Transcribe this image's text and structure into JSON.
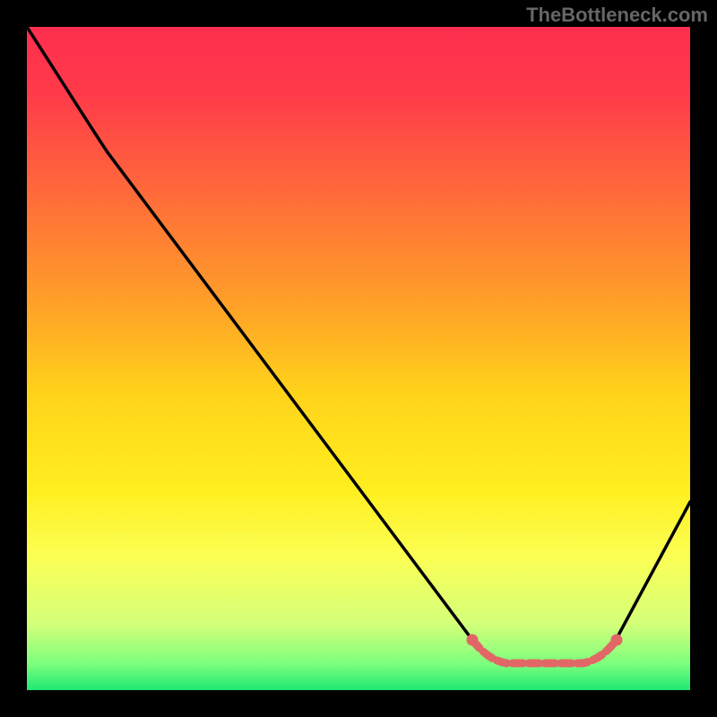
{
  "watermark": "TheBottleneck.com",
  "chart_data": {
    "type": "line",
    "title": "",
    "xlabel": "",
    "ylabel": "",
    "xlim": [
      0,
      100
    ],
    "ylim": [
      0,
      100
    ],
    "grid": false,
    "legend": false,
    "background_gradient": {
      "top": "#ff2e4f",
      "mid_top": "#ff9a2a",
      "mid": "#ffef20",
      "mid_bottom": "#d4ff7a",
      "bottom": "#1fe874"
    },
    "series": [
      {
        "name": "curve",
        "color": "#000000",
        "x": [
          0,
          5,
          10,
          15,
          20,
          25,
          30,
          35,
          40,
          45,
          50,
          55,
          60,
          63,
          66,
          70,
          75,
          80,
          83,
          86,
          90,
          95,
          100
        ],
        "y": [
          100,
          93,
          85,
          79,
          72,
          65,
          58,
          51,
          44,
          37,
          30,
          23,
          16,
          11,
          7,
          5,
          4,
          4,
          5,
          7,
          11,
          20,
          28
        ]
      },
      {
        "name": "optimal-range-highlight",
        "color": "#e16767",
        "style": "dashed",
        "x": [
          66,
          70,
          75,
          80,
          83,
          86
        ],
        "y": [
          7,
          5,
          4,
          4,
          5,
          7
        ]
      }
    ],
    "annotations": []
  }
}
